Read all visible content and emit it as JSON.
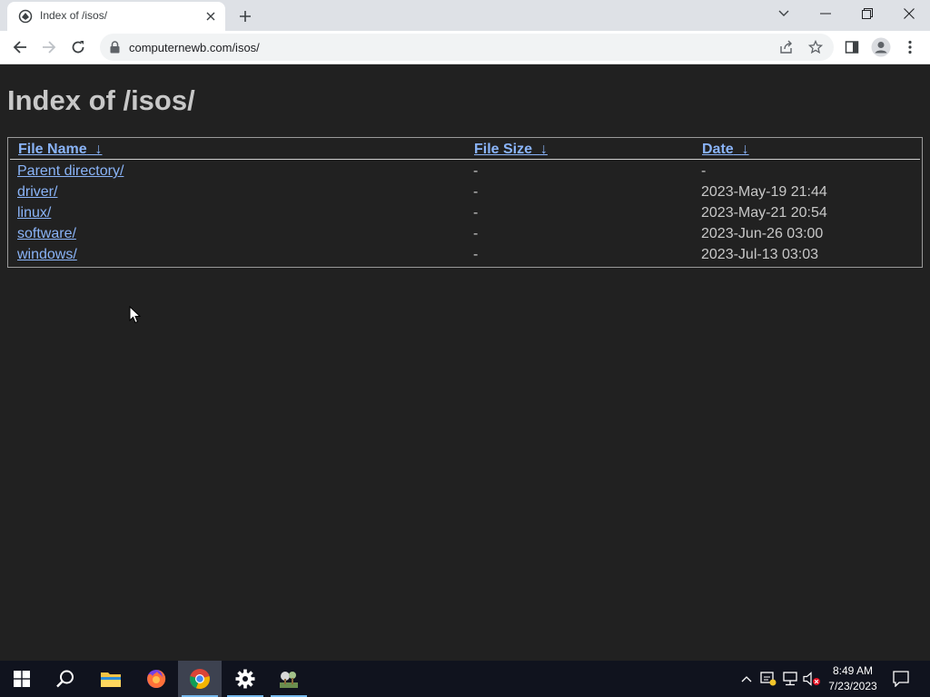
{
  "browser": {
    "tab_title": "Index of /isos/",
    "url_display": "computernewb.com/isos/"
  },
  "page": {
    "heading": "Index of /isos/",
    "columns": [
      {
        "label": "File Name",
        "sort_indicator": "↓"
      },
      {
        "label": "File Size",
        "sort_indicator": "↓"
      },
      {
        "label": "Date",
        "sort_indicator": "↓"
      }
    ],
    "rows": [
      {
        "name": "Parent directory/",
        "size": "-",
        "date": "-"
      },
      {
        "name": "driver/",
        "size": "-",
        "date": "2023-May-19 21:44"
      },
      {
        "name": "linux/",
        "size": "-",
        "date": "2023-May-21 20:54"
      },
      {
        "name": "software/",
        "size": "-",
        "date": "2023-Jun-26 03:00"
      },
      {
        "name": "windows/",
        "size": "-",
        "date": "2023-Jul-13 03:03"
      }
    ]
  },
  "taskbar": {
    "time": "8:49 AM",
    "date": "7/23/2023",
    "pinned": [
      "start-icon",
      "search-icon",
      "file-explorer-icon",
      "firefox-icon",
      "chrome-icon",
      "settings-icon",
      "app-icon"
    ]
  },
  "colors": {
    "page_background": "#212121",
    "link": "#8ab4f8",
    "text": "#c8c8c8",
    "taskbar": "#10131e"
  }
}
